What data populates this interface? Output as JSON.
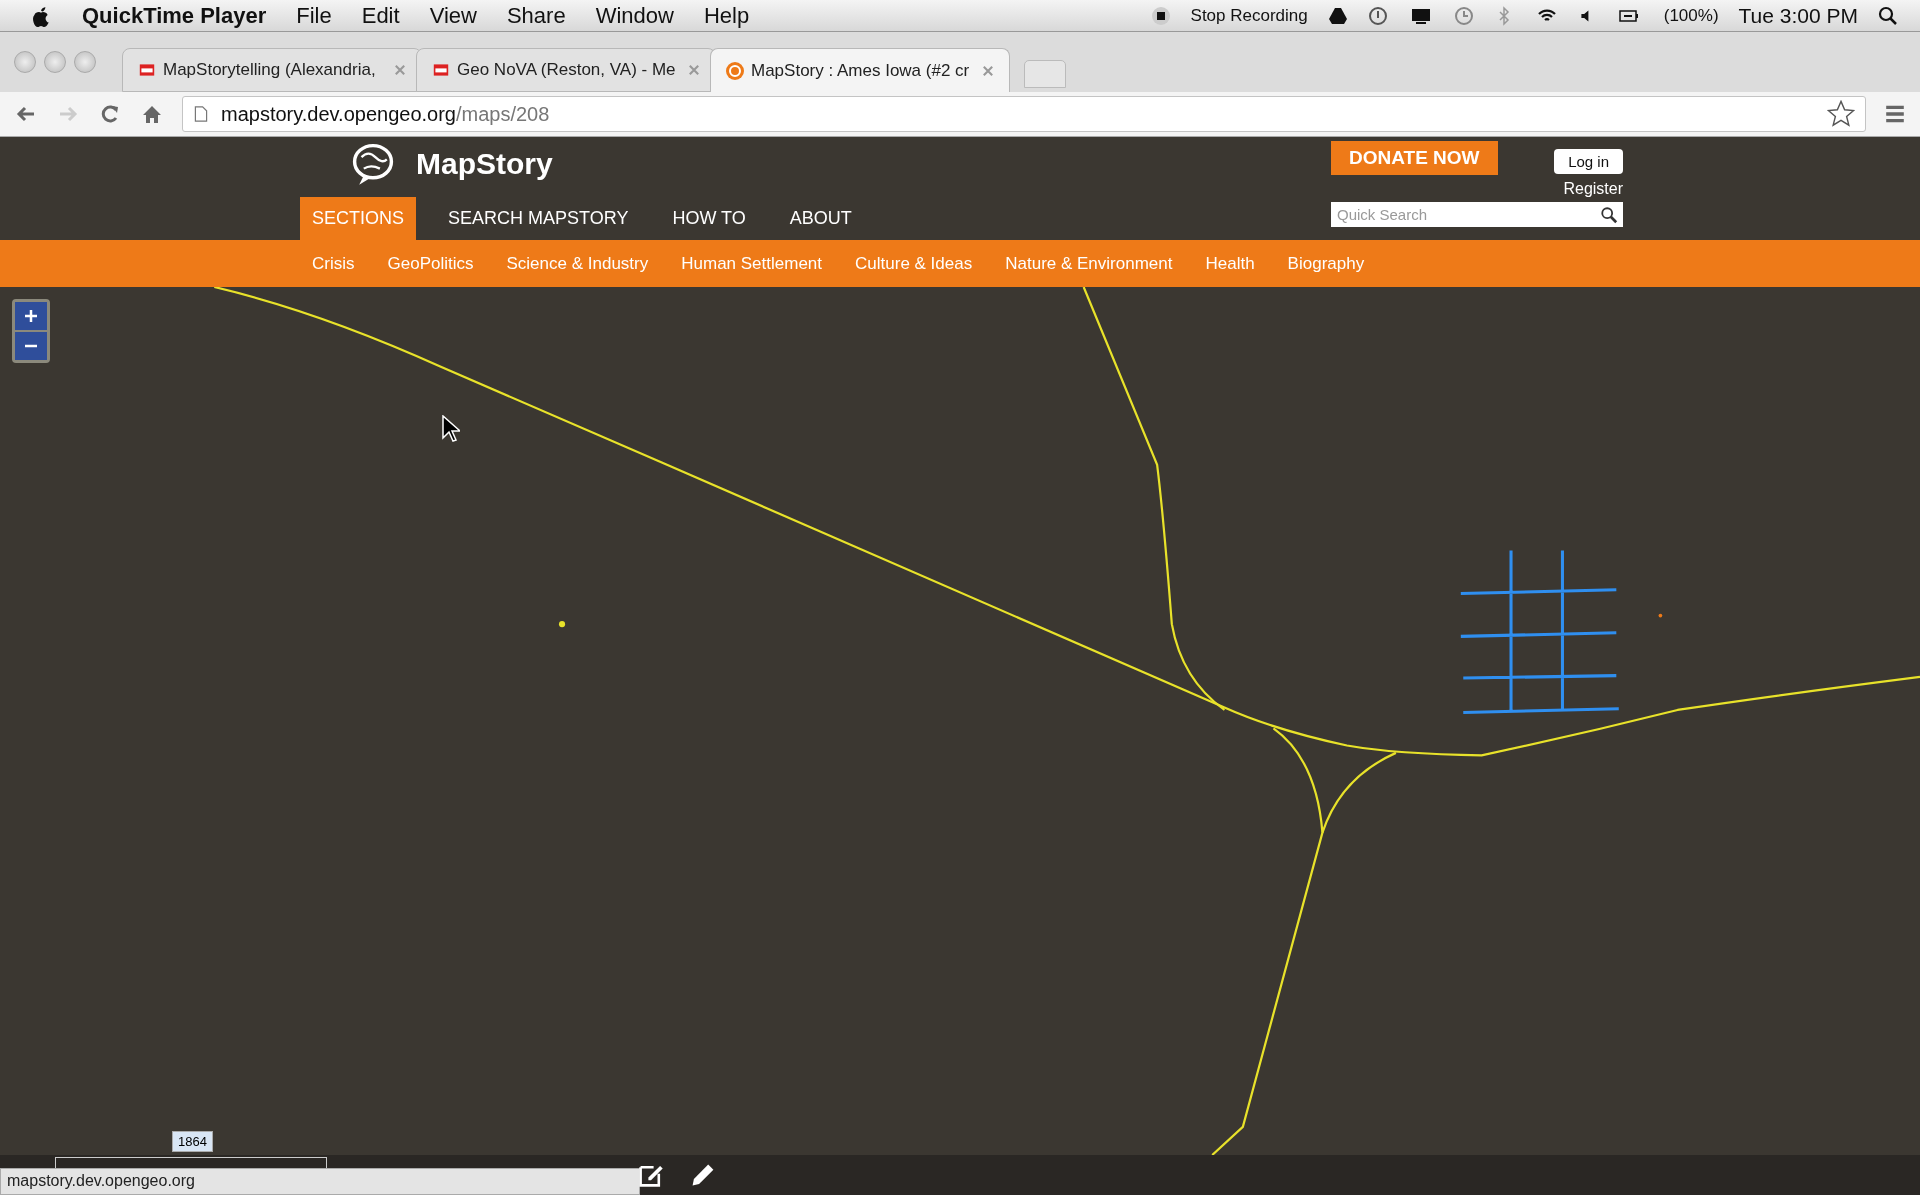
{
  "menu_bar": {
    "app": "QuickTime Player",
    "menus": [
      "File",
      "Edit",
      "View",
      "Share",
      "Window",
      "Help"
    ],
    "recording": "Stop Recording",
    "battery": "(100%)",
    "clock": "Tue 3:00 PM"
  },
  "tabs": [
    {
      "title": "MapStorytelling (Alexandria,",
      "selected": false,
      "kind": "meetup"
    },
    {
      "title": "Geo NoVA (Reston, VA) - Me",
      "selected": false,
      "kind": "meetup"
    },
    {
      "title": "MapStory : Ames Iowa (#2 cr",
      "selected": true,
      "kind": "mapstory"
    }
  ],
  "address": {
    "host": "mapstory.dev.opengeo.org",
    "path": "/maps/208"
  },
  "site": {
    "logo": "MapStory",
    "nav": [
      {
        "label": "SECTIONS",
        "selected": true
      },
      {
        "label": "SEARCH MAPSTORY",
        "selected": false
      },
      {
        "label": "HOW TO",
        "selected": false
      },
      {
        "label": "ABOUT",
        "selected": false
      }
    ],
    "donate": "DONATE NOW",
    "login": "Log in",
    "register": "Register",
    "search": {
      "placeholder": "Quick Search"
    },
    "categories": [
      "Crisis",
      "GeoPolitics",
      "Science & Industry",
      "Human Settlement",
      "Culture & Ideas",
      "Nature & Environment",
      "Health",
      "Biography"
    ]
  },
  "timeline": {
    "year": "1864"
  },
  "status_url": "mapstory.dev.opengeo.org"
}
